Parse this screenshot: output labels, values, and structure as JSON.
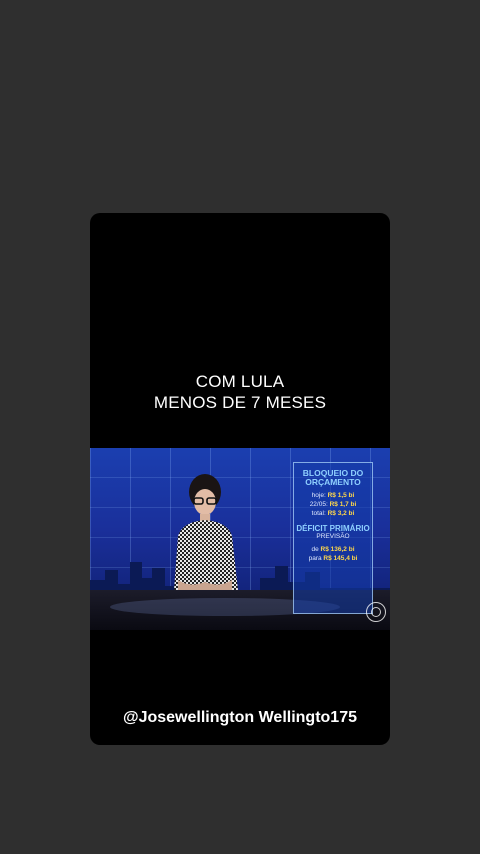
{
  "overlay": {
    "caption_line1": "COM LULA",
    "caption_line2": "MENOS DE 7 MESES",
    "handle": "@Josewellington Wellingto175"
  },
  "video": {
    "panel": {
      "title_line1": "BLOQUEIO DO",
      "title_line2": "ORÇAMENTO",
      "row1_label": "hoje:",
      "row1_value": "R$ 1,5 bi",
      "row2_label": "22/05:",
      "row2_value": "R$ 1,7 bi",
      "row3_label": "total:",
      "row3_value": "R$ 3,2 bi",
      "deficit_title": "DÉFICIT PRIMÁRIO",
      "deficit_sub": "PREVISÃO",
      "from_label": "de",
      "from_value": "R$ 136,2 bi",
      "to_label": "para",
      "to_value": "R$ 145,4 bi"
    },
    "logo_icon": "globo-logo-icon"
  },
  "colors": {
    "background": "#2f2f2f",
    "card": "#000000",
    "accent_value": "#ffd84a"
  }
}
